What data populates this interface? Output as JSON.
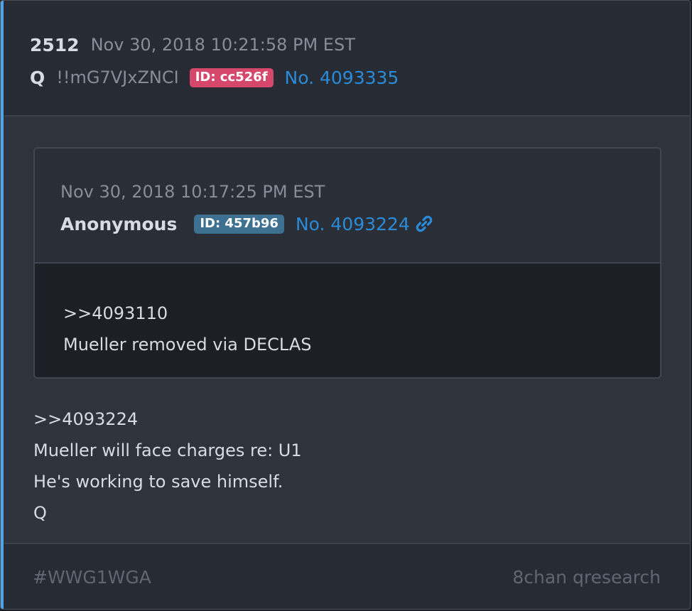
{
  "post": {
    "number": "2512",
    "timestamp": "Nov 30, 2018 10:21:58 PM EST",
    "author": "Q",
    "tripcode": "!!mG7VJxZNCI",
    "id_badge": "ID: cc526f",
    "post_link": "No. 4093335"
  },
  "quoted_post": {
    "timestamp": "Nov 30, 2018 10:17:25 PM EST",
    "author": "Anonymous",
    "id_badge": "ID: 457b96",
    "post_link": "No. 4093224",
    "link_icon": "link-icon",
    "body_lines": [
      ">>4093110",
      "Mueller removed via DECLAS"
    ]
  },
  "body_lines": [
    ">>4093224",
    "Mueller will face charges re: U1",
    "He's working to save himself.",
    "Q"
  ],
  "footer": {
    "hashtag": "#WWG1WGA",
    "source": "8chan qresearch"
  },
  "colors": {
    "accent": "#4fa3e6",
    "id_red": "#d6476c",
    "id_blue": "#3e7191",
    "link": "#2a8bd8"
  }
}
